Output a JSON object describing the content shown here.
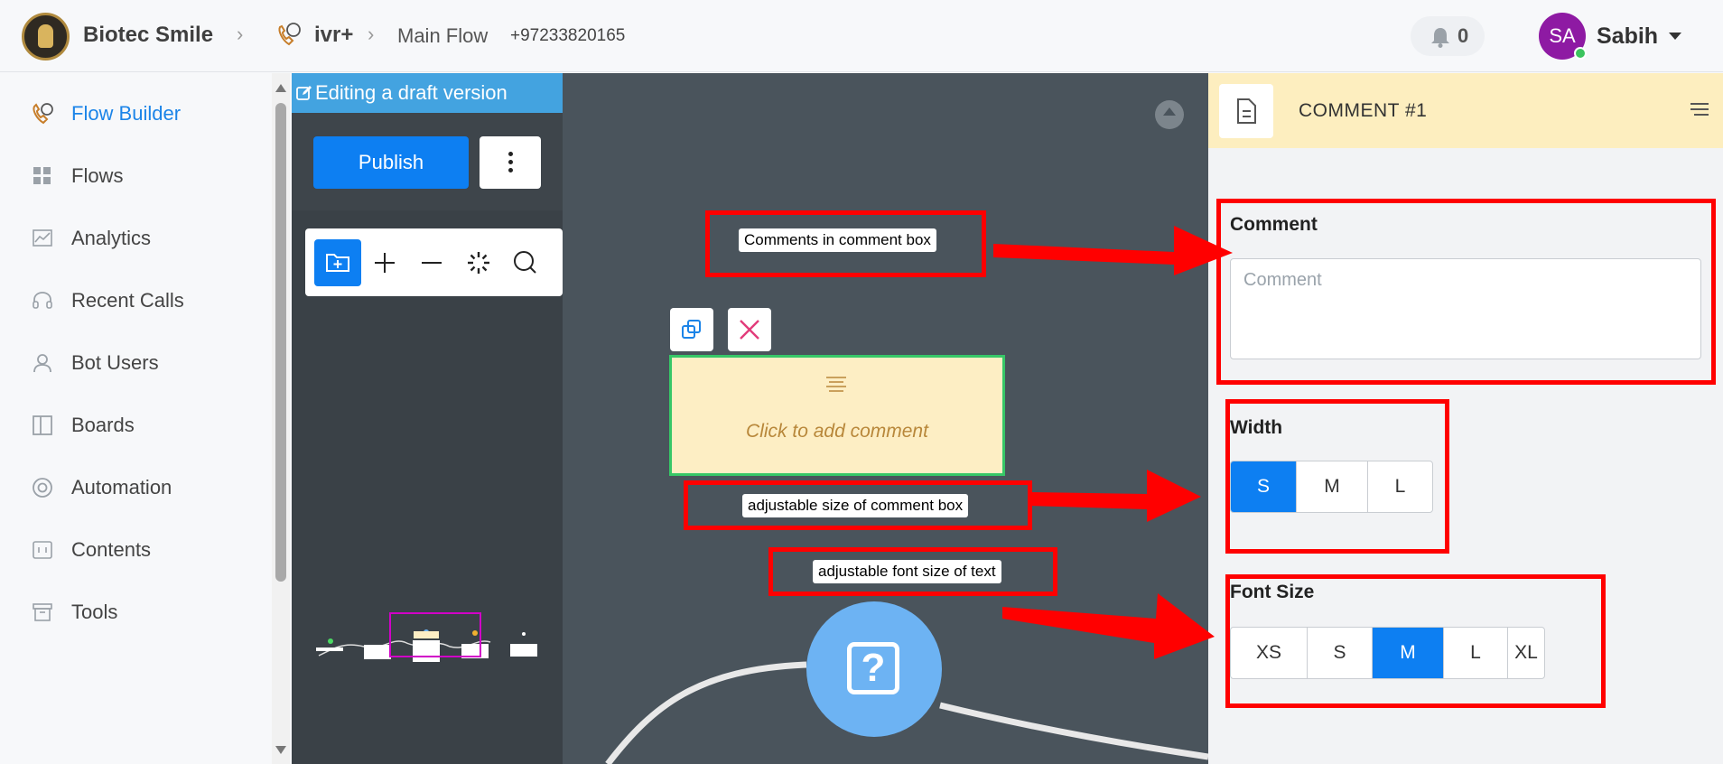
{
  "header": {
    "org_name": "Biotec Smile",
    "ivr_label": "ivr+",
    "flow_label": "Main Flow",
    "phone_number": "+97233820165",
    "notification_count": "0",
    "user_initials": "SA",
    "user_name": "Sabih"
  },
  "sidebar": {
    "items": [
      {
        "label": "Flow Builder",
        "icon": "phone-chat-icon",
        "active": true
      },
      {
        "label": "Flows",
        "icon": "grid-icon"
      },
      {
        "label": "Analytics",
        "icon": "chart-icon"
      },
      {
        "label": "Recent Calls",
        "icon": "headset-icon"
      },
      {
        "label": "Bot Users",
        "icon": "user-icon"
      },
      {
        "label": "Boards",
        "icon": "columns-icon"
      },
      {
        "label": "Automation",
        "icon": "lifebuoy-icon"
      },
      {
        "label": "Contents",
        "icon": "content-icon"
      },
      {
        "label": "Tools",
        "icon": "archive-icon"
      }
    ]
  },
  "canvas": {
    "draft_label": "Editing a draft version",
    "publish_label": "Publish",
    "comment_placeholder_text": "Click to add comment",
    "toolbar": [
      "add-folder-icon",
      "zoom-in-icon",
      "zoom-out-icon",
      "loader-icon",
      "search-icon"
    ]
  },
  "annotations": {
    "comment_box": "Comments in comment box",
    "size": "adjustable size of comment box",
    "font": "adjustable font size of text"
  },
  "panel": {
    "title": "COMMENT #1",
    "comment_label": "Comment",
    "comment_placeholder": "Comment",
    "width_label": "Width",
    "width_options": [
      "S",
      "M",
      "L"
    ],
    "width_selected": "S",
    "font_label": "Font Size",
    "font_options": [
      "XS",
      "S",
      "M",
      "L",
      "XL"
    ],
    "font_selected": "M"
  },
  "colors": {
    "accent": "#0d7ff2",
    "annotation": "#ff0000",
    "comment_bg": "#fdeec4"
  }
}
